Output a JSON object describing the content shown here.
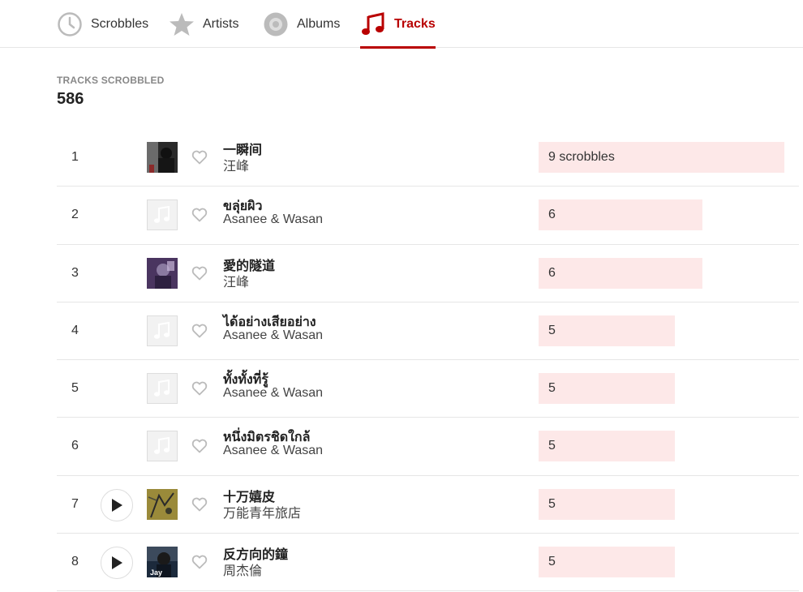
{
  "tabs": [
    {
      "label": "Scrobbles",
      "icon": "clock-icon",
      "active": false
    },
    {
      "label": "Artists",
      "icon": "star-icon",
      "active": false
    },
    {
      "label": "Albums",
      "icon": "disc-icon",
      "active": false
    },
    {
      "label": "Tracks",
      "icon": "music-note-icon",
      "active": true
    }
  ],
  "summary": {
    "label": "TRACKS SCROBBLED",
    "value": "586"
  },
  "accent_color": "#b90000",
  "bar_color": "#fde8e8",
  "max_scrobbles": 9,
  "tracks": [
    {
      "rank": "1",
      "title": "一瞬间",
      "artist": "汪峰",
      "scrobbles": 9,
      "count_label": "9 scrobbles",
      "cover": "artwork",
      "has_play": false
    },
    {
      "rank": "2",
      "title": "ขลุ่ยผิว",
      "artist": "Asanee & Wasan",
      "scrobbles": 6,
      "count_label": "6",
      "cover": "placeholder",
      "has_play": false
    },
    {
      "rank": "3",
      "title": "愛的隧道",
      "artist": "汪峰",
      "scrobbles": 6,
      "count_label": "6",
      "cover": "artwork",
      "has_play": false
    },
    {
      "rank": "4",
      "title": "ได้อย่างเสียอย่าง",
      "artist": "Asanee & Wasan",
      "scrobbles": 5,
      "count_label": "5",
      "cover": "placeholder",
      "has_play": false
    },
    {
      "rank": "5",
      "title": "ทั้งทั้งที่รู้",
      "artist": "Asanee & Wasan",
      "scrobbles": 5,
      "count_label": "5",
      "cover": "placeholder",
      "has_play": false
    },
    {
      "rank": "6",
      "title": "หนึ่งมิตรชิดใกล้",
      "artist": "Asanee & Wasan",
      "scrobbles": 5,
      "count_label": "5",
      "cover": "placeholder",
      "has_play": false
    },
    {
      "rank": "7",
      "title": "十万嬉皮",
      "artist": "万能青年旅店",
      "scrobbles": 5,
      "count_label": "5",
      "cover": "artwork",
      "has_play": true
    },
    {
      "rank": "8",
      "title": "反方向的鐘",
      "artist": "周杰倫",
      "scrobbles": 5,
      "count_label": "5",
      "cover": "artwork",
      "has_play": true
    }
  ]
}
